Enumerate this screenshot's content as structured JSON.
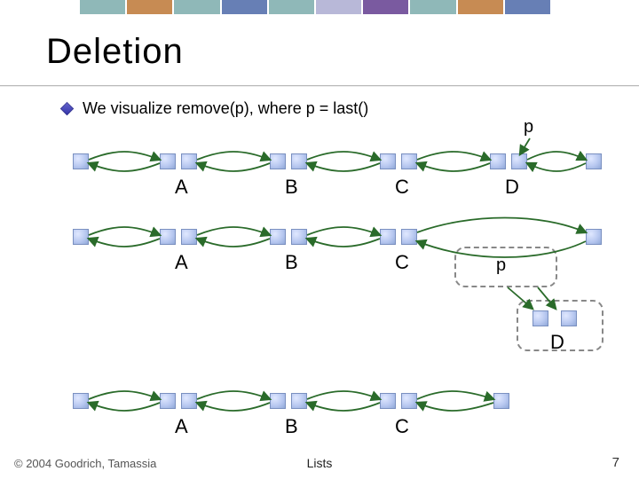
{
  "title": "Deletion",
  "bullet": "We visualize remove(p), where p = last()",
  "pointer_label_top": "p",
  "pointer_label_mid": "p",
  "rows": {
    "row1": {
      "labels": [
        "A",
        "B",
        "C",
        "D"
      ]
    },
    "row2": {
      "labels": [
        "A",
        "B",
        "C"
      ],
      "removed": "D"
    },
    "row3": {
      "labels": [
        "A",
        "B",
        "C"
      ]
    }
  },
  "footer": {
    "copyright": "© 2004 Goodrich, Tamassia",
    "topic": "Lists",
    "page": "7"
  }
}
